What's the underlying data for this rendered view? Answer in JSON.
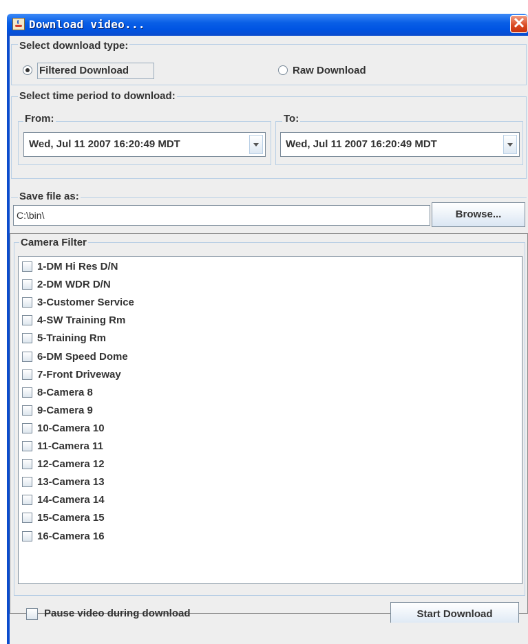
{
  "window": {
    "title": "Download video...",
    "close_glyph": "✕",
    "app_icon": "java-cup-icon"
  },
  "download_type": {
    "label": "Select download type:",
    "options": [
      {
        "label": "Filtered Download",
        "selected": true
      },
      {
        "label": "Raw Download",
        "selected": false
      }
    ]
  },
  "time_period": {
    "label": "Select time period to download:",
    "from": {
      "label": "From:",
      "value": "Wed, Jul 11 2007 16:20:49 MDT"
    },
    "to": {
      "label": "To:",
      "value": "Wed, Jul 11 2007 16:20:49 MDT"
    }
  },
  "save_file": {
    "label": "Save file as:",
    "value": "C:\\bin\\",
    "browse_label": "Browse..."
  },
  "camera_filter": {
    "label": "Camera Filter",
    "cameras": [
      "1-DM Hi Res D/N",
      "2-DM WDR D/N",
      "3-Customer Service",
      "4-SW Training Rm",
      "5-Training Rm",
      "6-DM Speed Dome",
      "7-Front Driveway",
      "8-Camera 8",
      "9-Camera 9",
      "10-Camera 10",
      "11-Camera 11",
      "12-Camera 12",
      "13-Camera 13",
      "14-Camera 14",
      "15-Camera 15",
      "16-Camera 16"
    ]
  },
  "footer": {
    "pause_label": "Pause video during download",
    "pause_checked": false,
    "start_label": "Start Download"
  },
  "colors": {
    "titlebar": "#0054e3",
    "close": "#d9471f",
    "panel_bg": "#eeeeee",
    "group_border": "#b8cfe5"
  }
}
